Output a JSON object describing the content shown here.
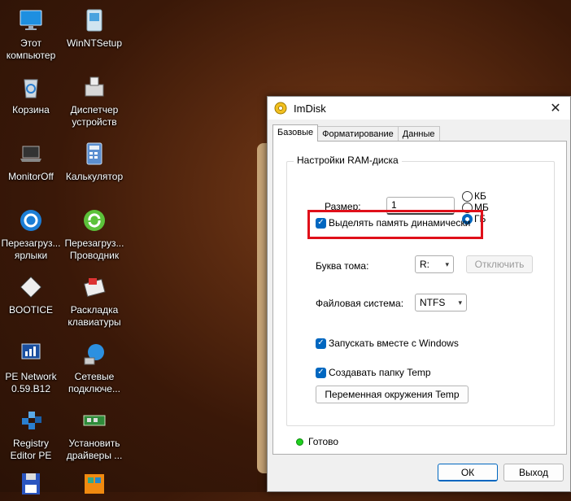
{
  "desktop": {
    "icons": [
      {
        "name": "this-pc",
        "label": "Этот\nкомпьютер",
        "icon": "monitor-icon"
      },
      {
        "name": "winntsetup",
        "label": "WinNTSetup",
        "icon": "setup-icon"
      },
      {
        "name": "recycle-bin",
        "label": "Корзина",
        "icon": "recycle-bin-icon"
      },
      {
        "name": "device-manager",
        "label": "Диспетчер\nустройств",
        "icon": "device-manager-icon"
      },
      {
        "name": "monitoroff",
        "label": "MonitorOff",
        "icon": "laptop-icon"
      },
      {
        "name": "calculator",
        "label": "Калькулятор",
        "icon": "calculator-icon"
      },
      {
        "name": "reload-shortcuts",
        "label": "Перезагруз...\nярлыки",
        "icon": "reload-shortcuts-icon"
      },
      {
        "name": "reload-explorer",
        "label": "Перезагруз...\nПроводник",
        "icon": "reload-explorer-icon"
      },
      {
        "name": "bootice",
        "label": "BOOTICE",
        "icon": "bootice-icon"
      },
      {
        "name": "keyboard-layout",
        "label": "Раскладка\nклавиатуры",
        "icon": "keyboard-layout-icon"
      },
      {
        "name": "pe-network",
        "label": "PE Network\n0.59.B12",
        "icon": "network-icon"
      },
      {
        "name": "network-connections",
        "label": "Сетевые\nподключе...",
        "icon": "globe-icon"
      },
      {
        "name": "registry-editor",
        "label": "Registry\nEditor PE",
        "icon": "registry-icon"
      },
      {
        "name": "install-drivers",
        "label": "Установить\nдрайверы ...",
        "icon": "drivers-icon"
      },
      {
        "name": "floppy",
        "label": "",
        "icon": "floppy-icon"
      },
      {
        "name": "windows-app",
        "label": "",
        "icon": "windows-app-icon"
      }
    ]
  },
  "dialog": {
    "title": "ImDisk",
    "close_glyph": "✕",
    "tabs": [
      {
        "label": "Базовые",
        "active": true
      },
      {
        "label": "Форматирование",
        "active": false
      },
      {
        "label": "Данные",
        "active": false
      }
    ],
    "group_title": "Настройки RAM-диска",
    "size_label": "Размер:",
    "size_value": "1",
    "units": [
      {
        "label": "КБ",
        "selected": false
      },
      {
        "label": "МБ",
        "selected": false
      },
      {
        "label": "ГБ",
        "selected": true
      }
    ],
    "dynamic_memory_label": "Выделять память динамически",
    "dynamic_memory_checked": true,
    "volume_letter_label": "Буква тома:",
    "volume_letter_value": "R:",
    "disconnect_label": "Отключить",
    "filesystem_label": "Файловая система:",
    "filesystem_value": "NTFS",
    "start_with_windows_label": "Запускать вместе с Windows",
    "create_temp_label": "Создавать папку Temp",
    "env_var_button": "Переменная окружения Temp",
    "status_text": "Готово",
    "ok_label": "ОК",
    "exit_label": "Выход",
    "colors": {
      "accent": "#0067c0",
      "highlight": "#e0101a",
      "status": "#20d020"
    }
  }
}
